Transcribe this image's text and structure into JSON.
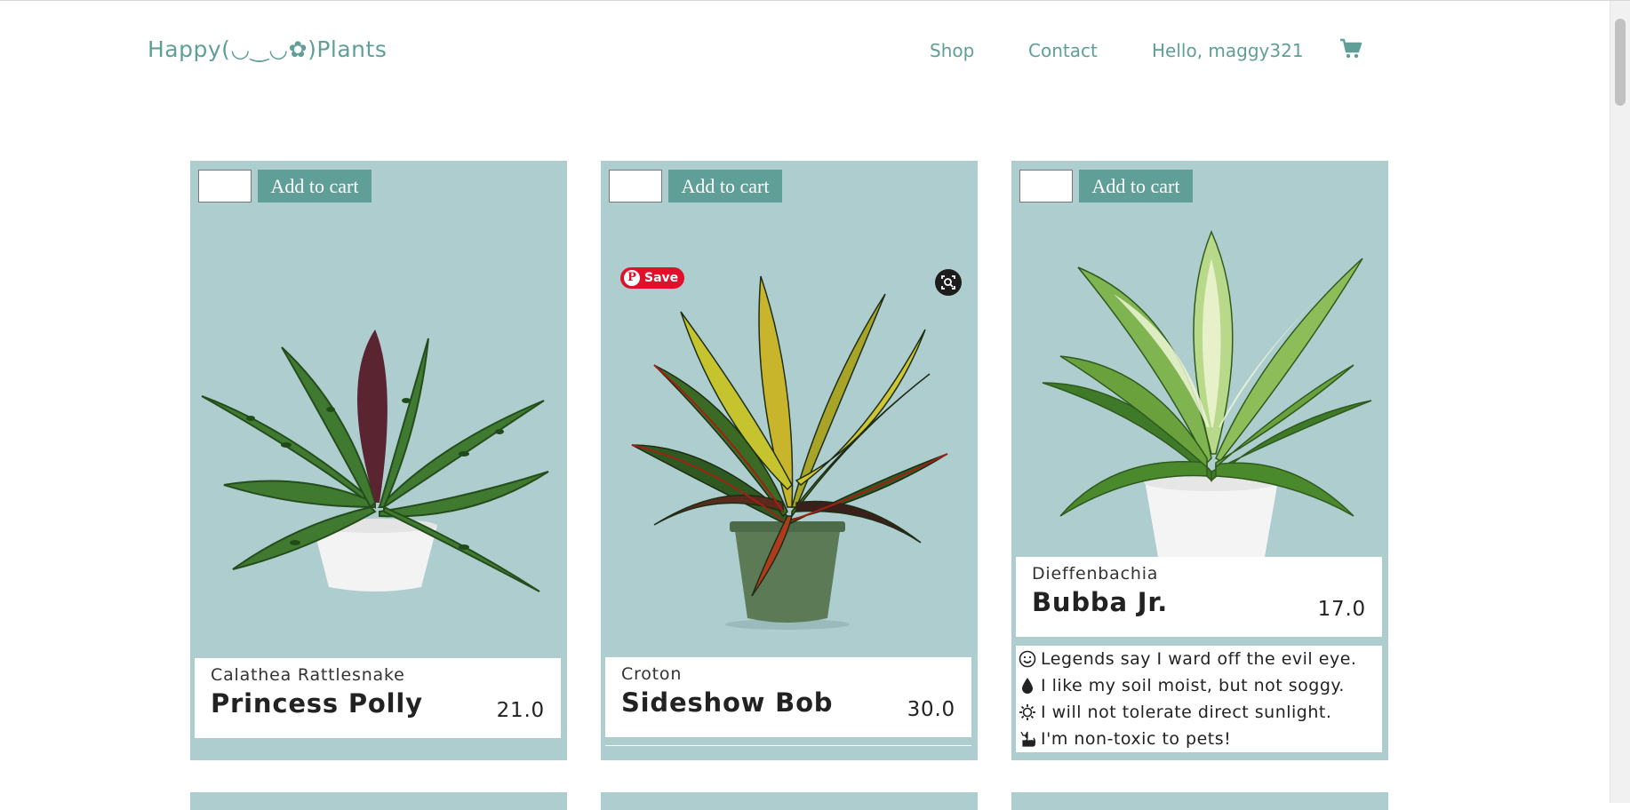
{
  "header": {
    "brand": "Happy(◡‿◡✿)Plants",
    "nav": {
      "shop": "Shop",
      "contact": "Contact",
      "greeting": "Hello, maggy321"
    }
  },
  "icons": {
    "cart": "shopping-cart-icon",
    "pin": "pinterest-icon",
    "lens": "visual-search-icon"
  },
  "colors": {
    "accent": "#5f9f97",
    "card_bg": "#aecdcf",
    "pinterest": "#e0102a"
  },
  "products": [
    {
      "add_label": "Add to cart",
      "quantity": "",
      "species": "Calathea Rattlesnake",
      "name": "Princess Polly",
      "price": "21.0"
    },
    {
      "add_label": "Add to cart",
      "quantity": "",
      "species": "Croton",
      "name": "Sideshow Bob",
      "price": "30.0",
      "pin_save": "Save"
    },
    {
      "add_label": "Add to cart",
      "quantity": "",
      "species": "Dieffenbachia",
      "name": "Bubba Jr.",
      "price": "17.0",
      "traits": [
        "Legends say I ward off the evil eye.",
        "I like my soil moist, but not soggy.",
        "I will not tolerate direct sunlight.",
        "I'm non-toxic to pets!"
      ]
    }
  ]
}
